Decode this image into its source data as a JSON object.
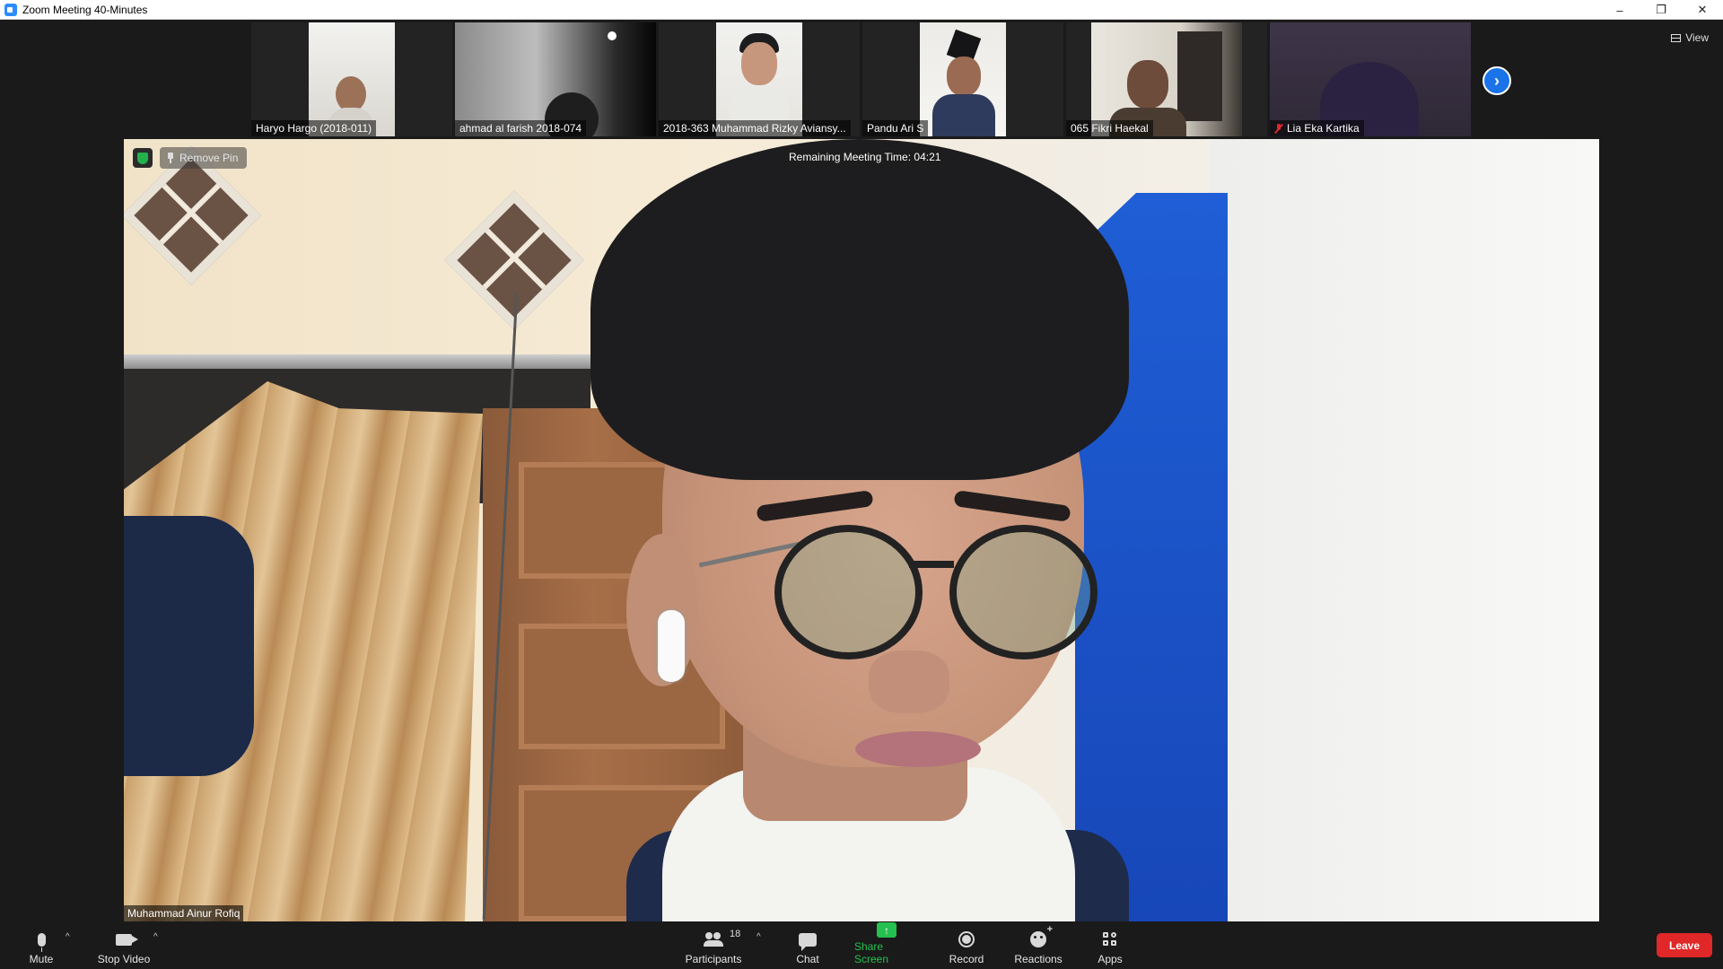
{
  "window": {
    "title": "Zoom Meeting 40-Minutes",
    "controls": {
      "minimize": "–",
      "restore": "❐",
      "close": "✕"
    }
  },
  "filmstrip": {
    "participants": [
      {
        "name": "Haryo Hargo (2018-011)",
        "muted": false
      },
      {
        "name": "ahmad al farish 2018-074",
        "muted": false
      },
      {
        "name": "2018-363 Muhammad Rizky Aviansy...",
        "muted": false
      },
      {
        "name": "Pandu Ari S",
        "muted": false
      },
      {
        "name": "065 Fikri Haekal",
        "muted": false
      },
      {
        "name": "Lia Eka Kartika",
        "muted": true
      }
    ],
    "next_icon": "chevron-right-icon",
    "view_label": "View"
  },
  "main": {
    "speaker_name": "Muhammad Ainur Rofiq",
    "remove_pin_label": "Remove Pin",
    "remaining_time": "Remaining Meeting Time: 04:21"
  },
  "toolbar": {
    "mute_label": "Mute",
    "stop_video_label": "Stop Video",
    "participants_label": "Participants",
    "participants_count": "18",
    "chat_label": "Chat",
    "share_screen_label": "Share Screen",
    "record_label": "Record",
    "reactions_label": "Reactions",
    "apps_label": "Apps",
    "leave_label": "Leave",
    "accent_share": "#25c04f",
    "accent_leave": "#e02828"
  }
}
